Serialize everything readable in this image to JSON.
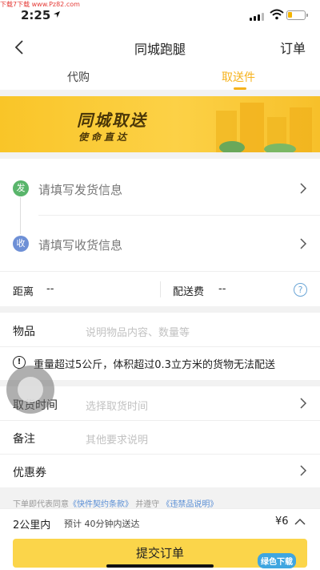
{
  "status_bar": {
    "time": "2:25",
    "watermark": "下载7下载 www.Pz82.com"
  },
  "nav": {
    "title": "同城跑腿",
    "right_label": "订单"
  },
  "tabs": [
    {
      "label": "代购"
    },
    {
      "label": "取送件",
      "active": true
    }
  ],
  "banner": {
    "title": "同城取送",
    "subtitle": "使命直达"
  },
  "address": {
    "send_badge": "发",
    "send_placeholder": "请填写发货信息",
    "recv_badge": "收",
    "recv_placeholder": "请填写收货信息"
  },
  "fee": {
    "distance_label": "距离",
    "distance_value": "--",
    "fee_label": "配送费",
    "fee_value": "--",
    "help": "?"
  },
  "goods": {
    "label": "物品",
    "placeholder": "说明物品内容、数量等",
    "warn_icon": "!",
    "warning": "重量超过5公斤，体积超过0.3立方米的货物无法配送"
  },
  "options": {
    "pickup_time_label": "取货时间",
    "pickup_time_placeholder": "选择取货时间",
    "remark_label": "备注",
    "remark_placeholder": "其他要求说明",
    "coupon_label": "优惠券"
  },
  "agreement": {
    "prefix": "下单即代表同意",
    "link1": "《快件契约条款》",
    "middle": "并遵守",
    "link2": "《违禁品说明》"
  },
  "summary": {
    "distance": "2公里内",
    "eta": "预计 40分钟内送达",
    "price": "¥6"
  },
  "submit_label": "提交订单",
  "site_logo": "绿色下载",
  "colors": {
    "accent": "#f6b21b",
    "button": "#fbd54a",
    "send": "#59b56b",
    "recv": "#6e90d6",
    "link": "#5a8fd6"
  }
}
